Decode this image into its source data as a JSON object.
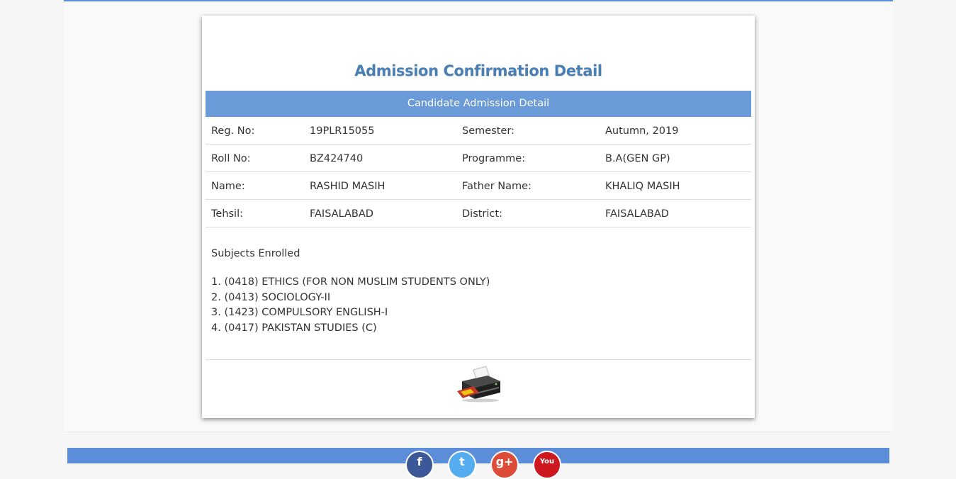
{
  "page": {
    "title": "Admission Confirmation Detail"
  },
  "table": {
    "header": "Candidate Admission Detail",
    "rows": [
      {
        "label1": "Reg. No:",
        "value1": "19PLR15055",
        "label2": "Semester:",
        "value2": "Autumn, 2019"
      },
      {
        "label1": "Roll No:",
        "value1": "BZ424740",
        "label2": "Programme:",
        "value2": "B.A(GEN GP)"
      },
      {
        "label1": "Name:",
        "value1": "RASHID MASIH",
        "label2": "Father Name:",
        "value2": "KHALIQ MASIH"
      },
      {
        "label1": "Tehsil:",
        "value1": "FAISALABAD",
        "label2": "District:",
        "value2": "FAISALABAD"
      }
    ]
  },
  "subjects": {
    "title": "Subjects Enrolled",
    "items": [
      "1. (0418) ETHICS (FOR NON MUSLIM STUDENTS ONLY)",
      "2. (0413) SOCIOLOGY-II",
      "3. (1423) COMPULSORY ENGLISH-I",
      "4. (0417) PAKISTAN STUDIES (C)"
    ]
  },
  "print": {
    "icon": "printer-icon"
  },
  "footer": {
    "social": [
      {
        "name": "facebook",
        "glyph": "f",
        "color": "#3b5998"
      },
      {
        "name": "twitter",
        "glyph": "t",
        "color": "#55acee"
      },
      {
        "name": "google-plus",
        "glyph": "g+",
        "color": "#dd4b39"
      },
      {
        "name": "youtube",
        "glyph": "You",
        "color": "#cc181e"
      }
    ]
  },
  "colors": {
    "accent": "#5b8dd9",
    "header_bar": "#6a9bd8",
    "title": "#4a7fb4"
  }
}
